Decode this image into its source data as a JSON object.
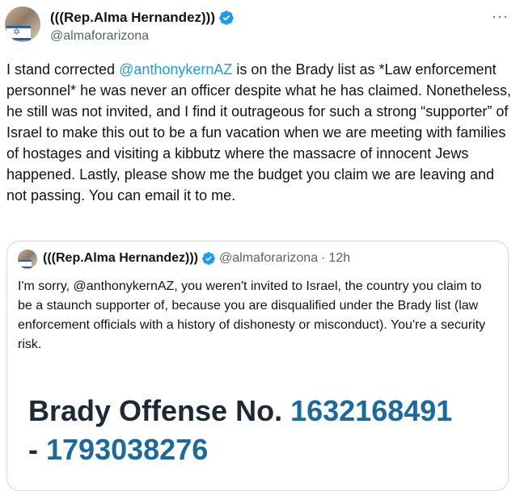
{
  "tweet": {
    "display_name": "(((Rep.Alma Hernandez)))",
    "handle": "@almaforarizona",
    "more_label": "···",
    "text_mention": "@anthonykernAZ",
    "text_before": "I stand corrected ",
    "text_after": " is on the Brady list as *Law enforcement personnel* he was never an officer despite what he has claimed. Nonetheless, he still was not invited, and I find it outrageous for such a strong “supporter” of Israel to make this out to be a fun vacation when we are meeting with families of hostages and visiting a kibbutz where the massacre of innocent Jews happened. Lastly, please show me the budget you claim we are leaving and not passing. You can email it to me."
  },
  "quote": {
    "display_name": "(((Rep.Alma Hernandez)))",
    "handle": "@almaforarizona",
    "separator": "·",
    "time": "12h",
    "text": "I'm sorry, @anthonykernAZ, you weren't invited to Israel, the country you claim to be a staunch supporter of, because you are disqualified under the Brady list (law enforcement officials with a history of dishonesty or misconduct). You're a security risk.",
    "media": {
      "label": "Brady Offense No.",
      "number": "1632168491",
      "dash": "-",
      "number2": "1793038276"
    }
  },
  "colors": {
    "mention": "#1d9bf0",
    "verified": "#1d9bf0",
    "muted": "#536471",
    "offense_number": "#1a6aa0"
  },
  "icons": {
    "verified": "verified-badge-icon",
    "more": "more-options-icon"
  }
}
